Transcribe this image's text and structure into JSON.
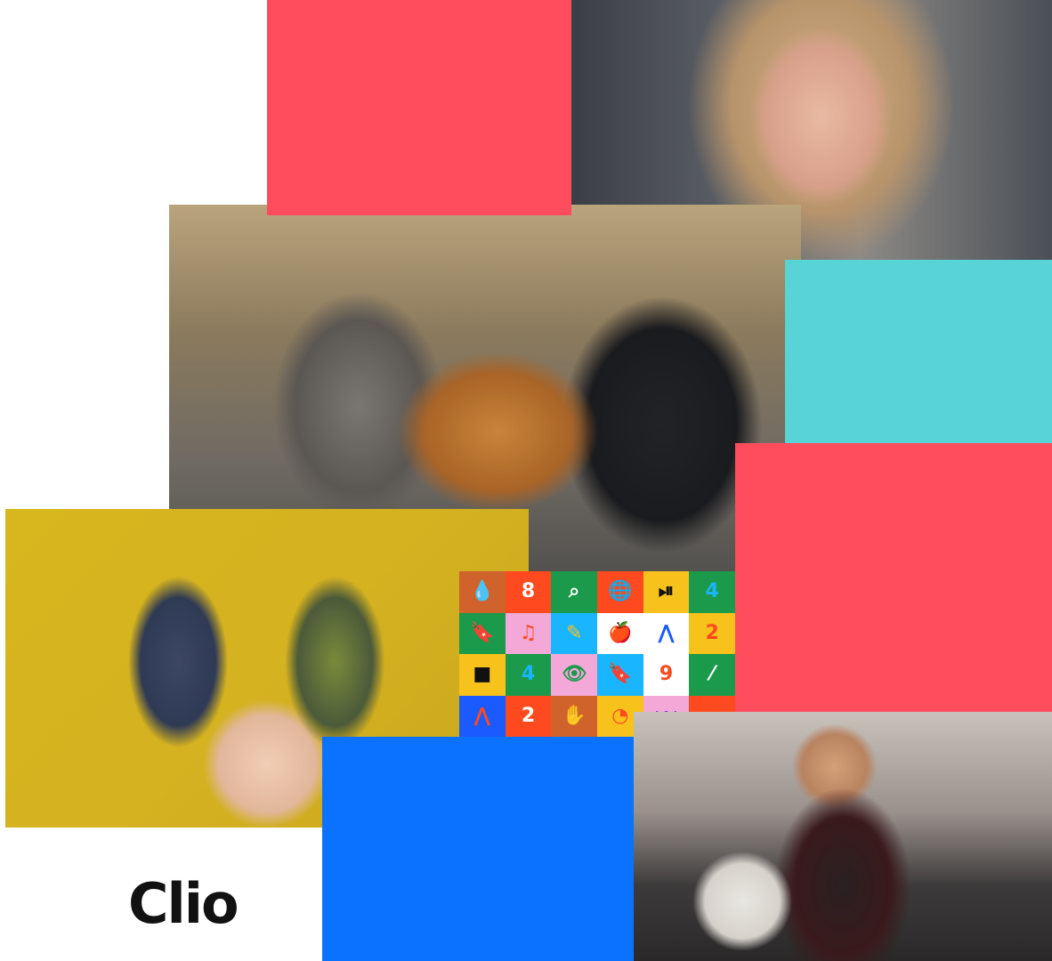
{
  "logo": {
    "text": "Clio"
  },
  "colors": {
    "coral": "#ff4d5e",
    "teal": "#58d3d6",
    "blue": "#0a72ff",
    "white": "#ffffff"
  },
  "photos": [
    {
      "name": "girl-smiling-photo"
    },
    {
      "name": "group-laughing-photo"
    },
    {
      "name": "painted-hands-photo"
    },
    {
      "name": "boy-football-photo"
    }
  ],
  "icon_grid": [
    {
      "bg": "#d0622b",
      "fg": "#0a3a7a",
      "glyph": "💧",
      "icon": "droplet-icon"
    },
    {
      "bg": "#ff4a1f",
      "fg": "#ffffff",
      "glyph": "8",
      "icon": "number-8"
    },
    {
      "bg": "#1a9a4a",
      "fg": "#ffffff",
      "glyph": "⌕",
      "icon": "magnifier-icon"
    },
    {
      "bg": "#ff4a1f",
      "fg": "#3a2ab8",
      "glyph": "🌐",
      "icon": "globe-icon"
    },
    {
      "bg": "#f7c21c",
      "fg": "#111111",
      "glyph": "⏯",
      "icon": "play-pause-icon"
    },
    {
      "bg": "#1a9a4a",
      "fg": "#1ab5ff",
      "glyph": "4",
      "icon": "number-4"
    },
    {
      "bg": "#1a9a4a",
      "fg": "#f7c21c",
      "glyph": "🔖",
      "icon": "bookmark-icon"
    },
    {
      "bg": "#f4a8d8",
      "fg": "#ff4a1f",
      "glyph": "♫",
      "icon": "music-note-icon"
    },
    {
      "bg": "#1ab5ff",
      "fg": "#f7c21c",
      "glyph": "✎",
      "icon": "pencil-icon"
    },
    {
      "bg": "#ffffff",
      "fg": "#ff4a1f",
      "glyph": "🍎",
      "icon": "apple-icon"
    },
    {
      "bg": "#ffffff",
      "fg": "#1a5aff",
      "glyph": "⋀",
      "icon": "compass-icon"
    },
    {
      "bg": "#f7c21c",
      "fg": "#ff4a1f",
      "glyph": "2",
      "icon": "number-2"
    },
    {
      "bg": "#f7c21c",
      "fg": "#111111",
      "glyph": "■",
      "icon": "square-icon"
    },
    {
      "bg": "#1a9a4a",
      "fg": "#1ab5ff",
      "glyph": "4",
      "icon": "number-4"
    },
    {
      "bg": "#f4a8d8",
      "fg": "#1a9a4a",
      "glyph": "👁",
      "icon": "eye-icon"
    },
    {
      "bg": "#1ab5ff",
      "fg": "#f7c21c",
      "glyph": "🔖",
      "icon": "bookmark-icon"
    },
    {
      "bg": "#ffffff",
      "fg": "#ff4a1f",
      "glyph": "9",
      "icon": "number-9"
    },
    {
      "bg": "#1a9a4a",
      "fg": "#ffffff",
      "glyph": "⁄",
      "icon": "leaf-icon"
    },
    {
      "bg": "#1a5aff",
      "fg": "#ff4a1f",
      "glyph": "⋀",
      "icon": "compass-icon"
    },
    {
      "bg": "#ff4a1f",
      "fg": "#ffffff",
      "glyph": "2",
      "icon": "number-2"
    },
    {
      "bg": "#d0622b",
      "fg": "#f4a8d8",
      "glyph": "✋",
      "icon": "hand-icon"
    },
    {
      "bg": "#f7c21c",
      "fg": "#ff4a1f",
      "glyph": "◔",
      "icon": "target-icon"
    },
    {
      "bg": "#f4a8d8",
      "fg": "#3a2ab8",
      "glyph": "〰",
      "icon": "sound-wave-icon"
    },
    {
      "bg": "#ff4a1f",
      "fg": "#1a5aff",
      "glyph": "⌕",
      "icon": "magnifier-icon"
    }
  ]
}
